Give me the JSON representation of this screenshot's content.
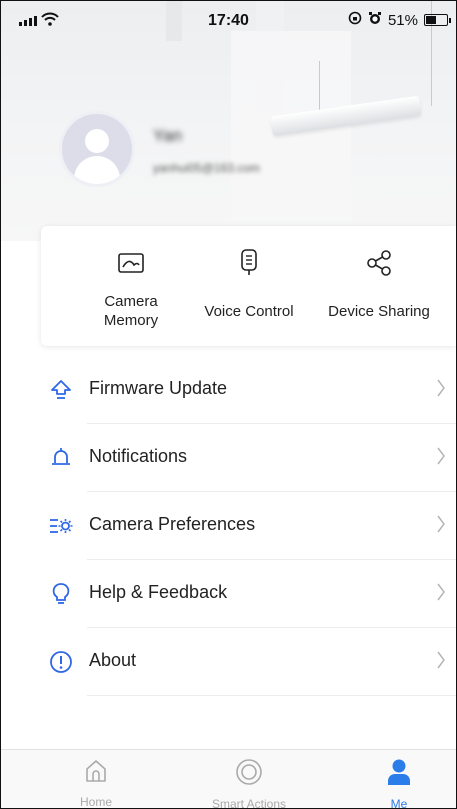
{
  "status_bar": {
    "time": "17:40",
    "battery": "51%",
    "battery_level": 0.51
  },
  "profile": {
    "name": "Yan",
    "email": "yanhui05@163.com"
  },
  "features": [
    {
      "label": "Camera\nMemory",
      "icon": "picture-icon"
    },
    {
      "label": "Voice Control",
      "icon": "voice-assistant-icon"
    },
    {
      "label": "Device Sharing",
      "icon": "share-icon"
    }
  ],
  "menu": [
    {
      "label": "Firmware Update",
      "icon": "upload-arrow-icon"
    },
    {
      "label": "Notifications",
      "icon": "bell-icon"
    },
    {
      "label": "Camera Preferences",
      "icon": "settings-sliders-icon"
    },
    {
      "label": "Help & Feedback",
      "icon": "lightbulb-icon"
    },
    {
      "label": "About",
      "icon": "info-icon"
    }
  ],
  "tabs": [
    {
      "label": "Home",
      "icon": "home-icon",
      "active": false
    },
    {
      "label": "Smart Actions",
      "icon": "smart-actions-icon",
      "active": false
    },
    {
      "label": "Me",
      "icon": "person-icon",
      "active": true
    }
  ],
  "colors": {
    "accent": "#2b7de9",
    "menu_icon": "#2f68e6",
    "inactive": "#aaaaaa"
  }
}
